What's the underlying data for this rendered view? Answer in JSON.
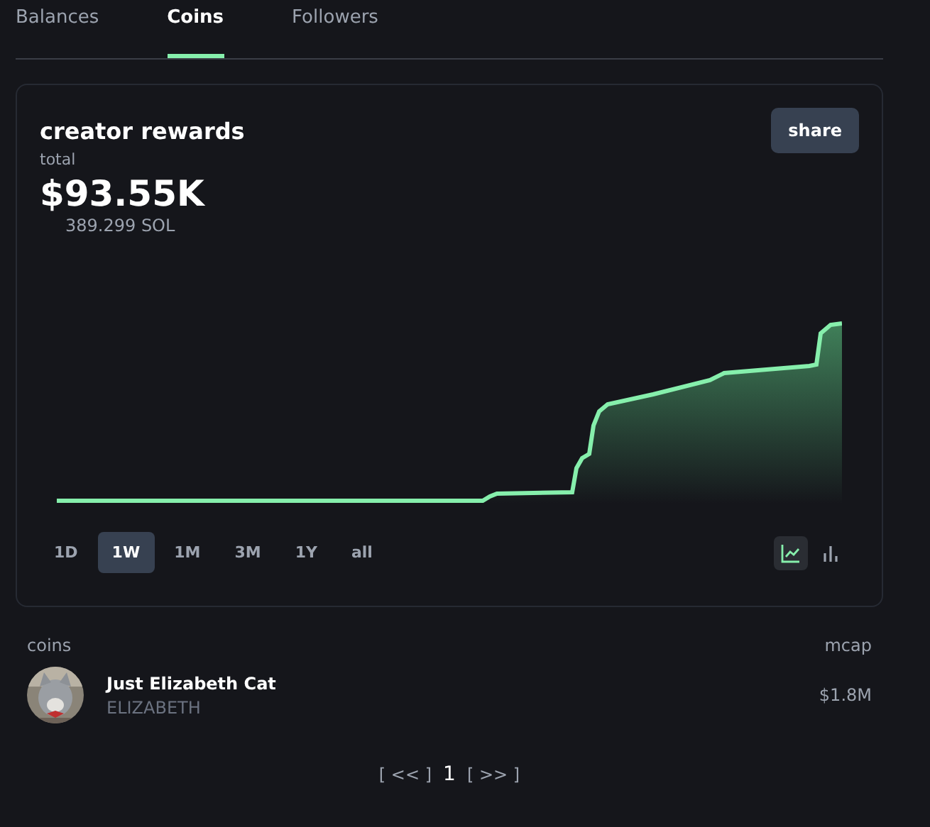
{
  "tabs": [
    {
      "label": "Balances",
      "selected": false
    },
    {
      "label": "Coins",
      "selected": true
    },
    {
      "label": "Followers",
      "selected": false
    }
  ],
  "rewards": {
    "title": "creator rewards",
    "share_button": "share",
    "total_label": "total",
    "total": "$93.55K",
    "sol": "389.299 SOL",
    "periods": [
      {
        "label": "1D",
        "selected": false
      },
      {
        "label": "1W",
        "selected": true
      },
      {
        "label": "1M",
        "selected": false
      },
      {
        "label": "3M",
        "selected": false
      },
      {
        "label": "1Y",
        "selected": false
      },
      {
        "label": "all",
        "selected": false
      }
    ],
    "chart_types": [
      {
        "kind": "line",
        "selected": true
      },
      {
        "kind": "bar",
        "selected": false
      }
    ]
  },
  "coins": {
    "header": "coins",
    "mcap_header": "mcap",
    "rows": [
      {
        "name": "Just Elizabeth Cat",
        "ticker": "ELIZABETH",
        "mcap": "$1.8M"
      }
    ]
  },
  "pagination": {
    "prev": "[ << ]",
    "page": "1",
    "next": "[ >> ]"
  }
}
